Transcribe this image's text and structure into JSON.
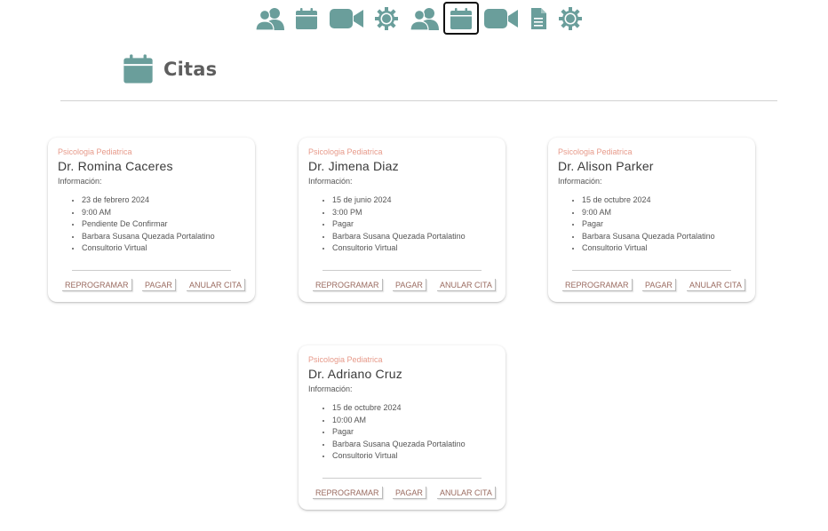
{
  "nav": {
    "items": [
      {
        "icon": "users-icon"
      },
      {
        "icon": "calendar-icon"
      },
      {
        "icon": "video-icon"
      },
      {
        "icon": "settings-gear-icon"
      },
      {
        "icon": "users-icon"
      },
      {
        "icon": "calendar-icon",
        "active": true
      },
      {
        "icon": "video-icon"
      },
      {
        "icon": "document-icon"
      },
      {
        "icon": "settings-gear-icon"
      }
    ]
  },
  "page": {
    "title": "Citas",
    "icon": "calendar-icon"
  },
  "colors": {
    "icon_teal": "#6a9e9b",
    "specialty": "#e79a8a",
    "action_text": "#9a6b60"
  },
  "appointments": [
    {
      "specialty": "Psicologia Pediatrica",
      "doctor": "Dr. Romina Caceres",
      "info_label": "Información:",
      "details": [
        "23 de febrero 2024",
        "9:00 AM",
        "Pendiente De Confirmar",
        "Barbara Susana Quezada Portalatino",
        "Consultorio Virtual"
      ],
      "actions": {
        "reschedule": "REPROGRAMAR",
        "pay": "PAGAR",
        "cancel": "ANULAR CITA"
      }
    },
    {
      "specialty": "Psicologia Pediatrica",
      "doctor": "Dr. Jimena Diaz",
      "info_label": "Información:",
      "details": [
        "15 de junio 2024",
        "3:00 PM",
        "Pagar",
        "Barbara Susana Quezada Portalatino",
        "Consultorio Virtual"
      ],
      "actions": {
        "reschedule": "REPROGRAMAR",
        "pay": "PAGAR",
        "cancel": "ANULAR CITA"
      }
    },
    {
      "specialty": "Psicologia Pediatrica",
      "doctor": "Dr. Alison Parker",
      "info_label": "Información:",
      "details": [
        "15 de octubre 2024",
        "9:00 AM",
        "Pagar",
        "Barbara Susana Quezada Portalatino",
        "Consultorio Virtual"
      ],
      "actions": {
        "reschedule": "REPROGRAMAR",
        "pay": "PAGAR",
        "cancel": "ANULAR CITA"
      }
    },
    {
      "specialty": "Psicologia Pediatrica",
      "doctor": "Dr. Adriano Cruz",
      "info_label": "Información:",
      "details": [
        "15 de octubre 2024",
        "10:00 AM",
        "Pagar",
        "Barbara Susana Quezada Portalatino",
        "Consultorio Virtual"
      ],
      "actions": {
        "reschedule": "REPROGRAMAR",
        "pay": "PAGAR",
        "cancel": "ANULAR CITA"
      }
    }
  ]
}
